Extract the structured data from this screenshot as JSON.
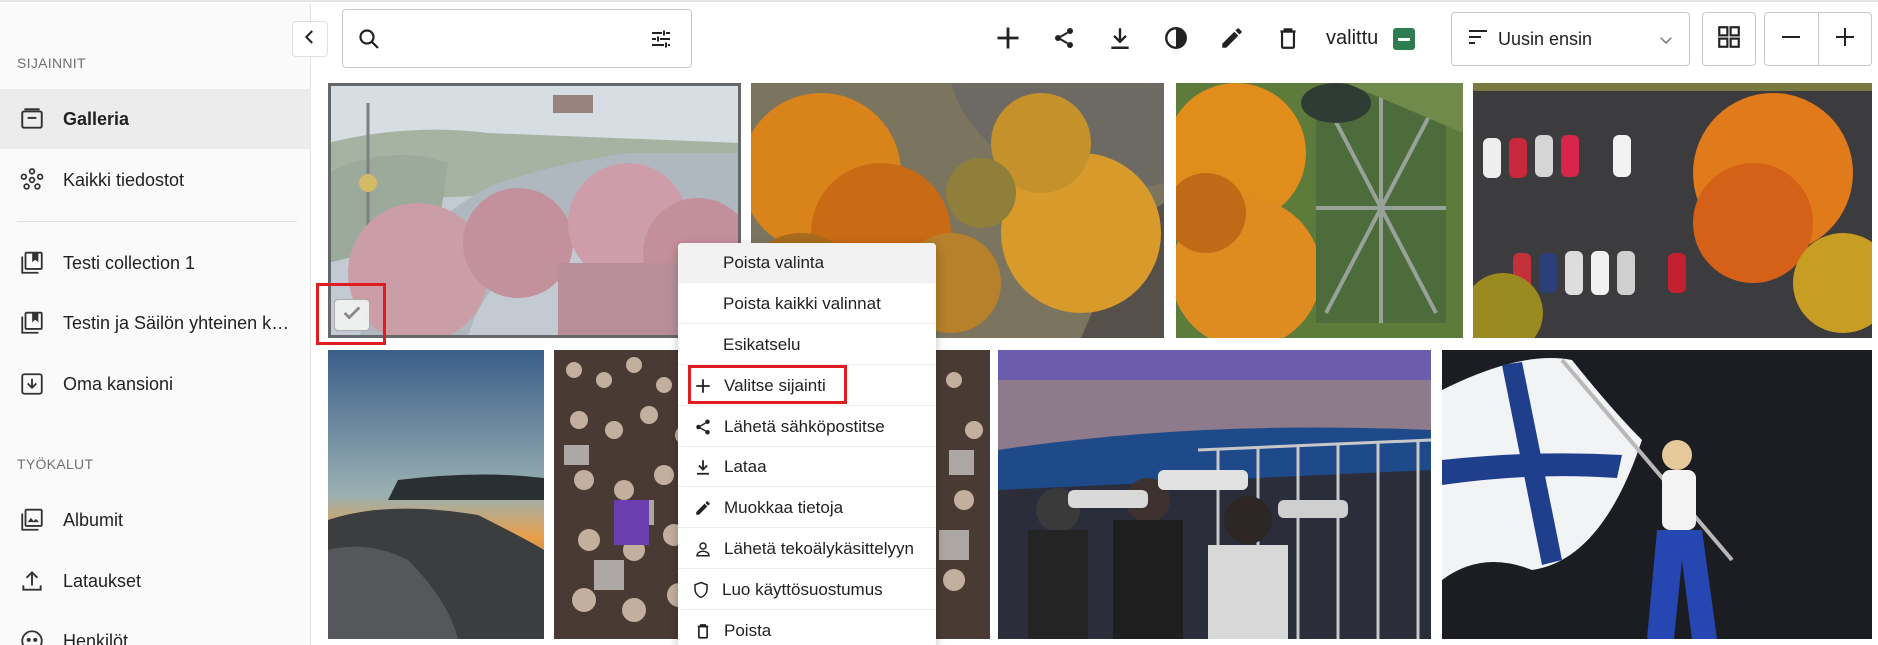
{
  "sidebar": {
    "section_locations": "SIJAINNIT",
    "section_tools": "TYÖKALUT",
    "locations": [
      {
        "label": "Galleria",
        "icon": "gallery-icon",
        "active": true
      },
      {
        "label": "Kaikki tiedostot",
        "icon": "all-files-icon",
        "active": false
      },
      {
        "label": "Testi collection 1",
        "icon": "collection-icon",
        "active": false
      },
      {
        "label": "Testin ja Säilön yhteinen kok…",
        "icon": "collection-icon",
        "active": false
      },
      {
        "label": "Oma kansioni",
        "icon": "folder-download-icon",
        "active": false
      }
    ],
    "tools": [
      {
        "label": "Albumit",
        "icon": "album-icon"
      },
      {
        "label": "Lataukset",
        "icon": "upload-icon"
      },
      {
        "label": "Henkilöt",
        "icon": "people-icon"
      }
    ]
  },
  "toolbar": {
    "search_placeholder": "",
    "selected_label": "valittu",
    "sort_label": "Uusin ensin",
    "accent_color": "#2e7d4f"
  },
  "context_menu": {
    "items": [
      {
        "label": "Poista valinta",
        "icon": ""
      },
      {
        "label": "Poista kaikki valinnat",
        "icon": ""
      },
      {
        "label": "Esikatselu",
        "icon": ""
      },
      {
        "label": "Valitse sijainti",
        "icon": "plus-icon"
      },
      {
        "label": "Lähetä sähköpostitse",
        "icon": "share-icon"
      },
      {
        "label": "Lataa",
        "icon": "download-icon"
      },
      {
        "label": "Muokkaa tietoja",
        "icon": "edit-icon"
      },
      {
        "label": "Lähetä tekoälykäsittelyyn",
        "icon": "person-icon"
      },
      {
        "label": "Luo käyttösuostumus",
        "icon": "shield-icon"
      },
      {
        "label": "Poista",
        "icon": "trash-icon"
      }
    ],
    "highlight_color": "#e11b22"
  }
}
